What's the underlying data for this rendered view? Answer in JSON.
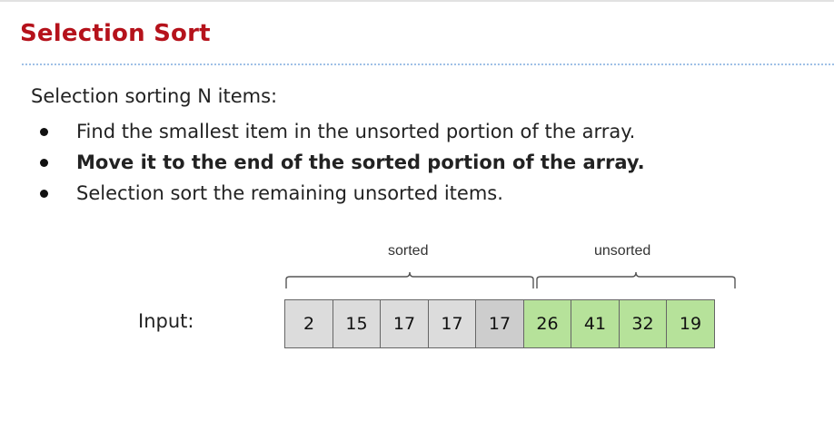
{
  "slide": {
    "title": "Selection Sort",
    "intro": "Selection sorting N items:",
    "bullets": [
      "Find the smallest item in the unsorted portion of the array.",
      "Move it to the end of the sorted portion of the array.",
      "Selection sort the remaining unsorted items."
    ]
  },
  "figure": {
    "sorted_label": "sorted",
    "unsorted_label": "unsorted",
    "input_label": "Input:",
    "cells": [
      "2",
      "15",
      "17",
      "17",
      "17",
      "26",
      "41",
      "32",
      "19"
    ],
    "colors": {
      "title": "#b5121b",
      "sorted_cell": "#dcdcdc",
      "current_cell": "#cdcdcd",
      "unsorted_cell": "#b6e29a"
    }
  }
}
